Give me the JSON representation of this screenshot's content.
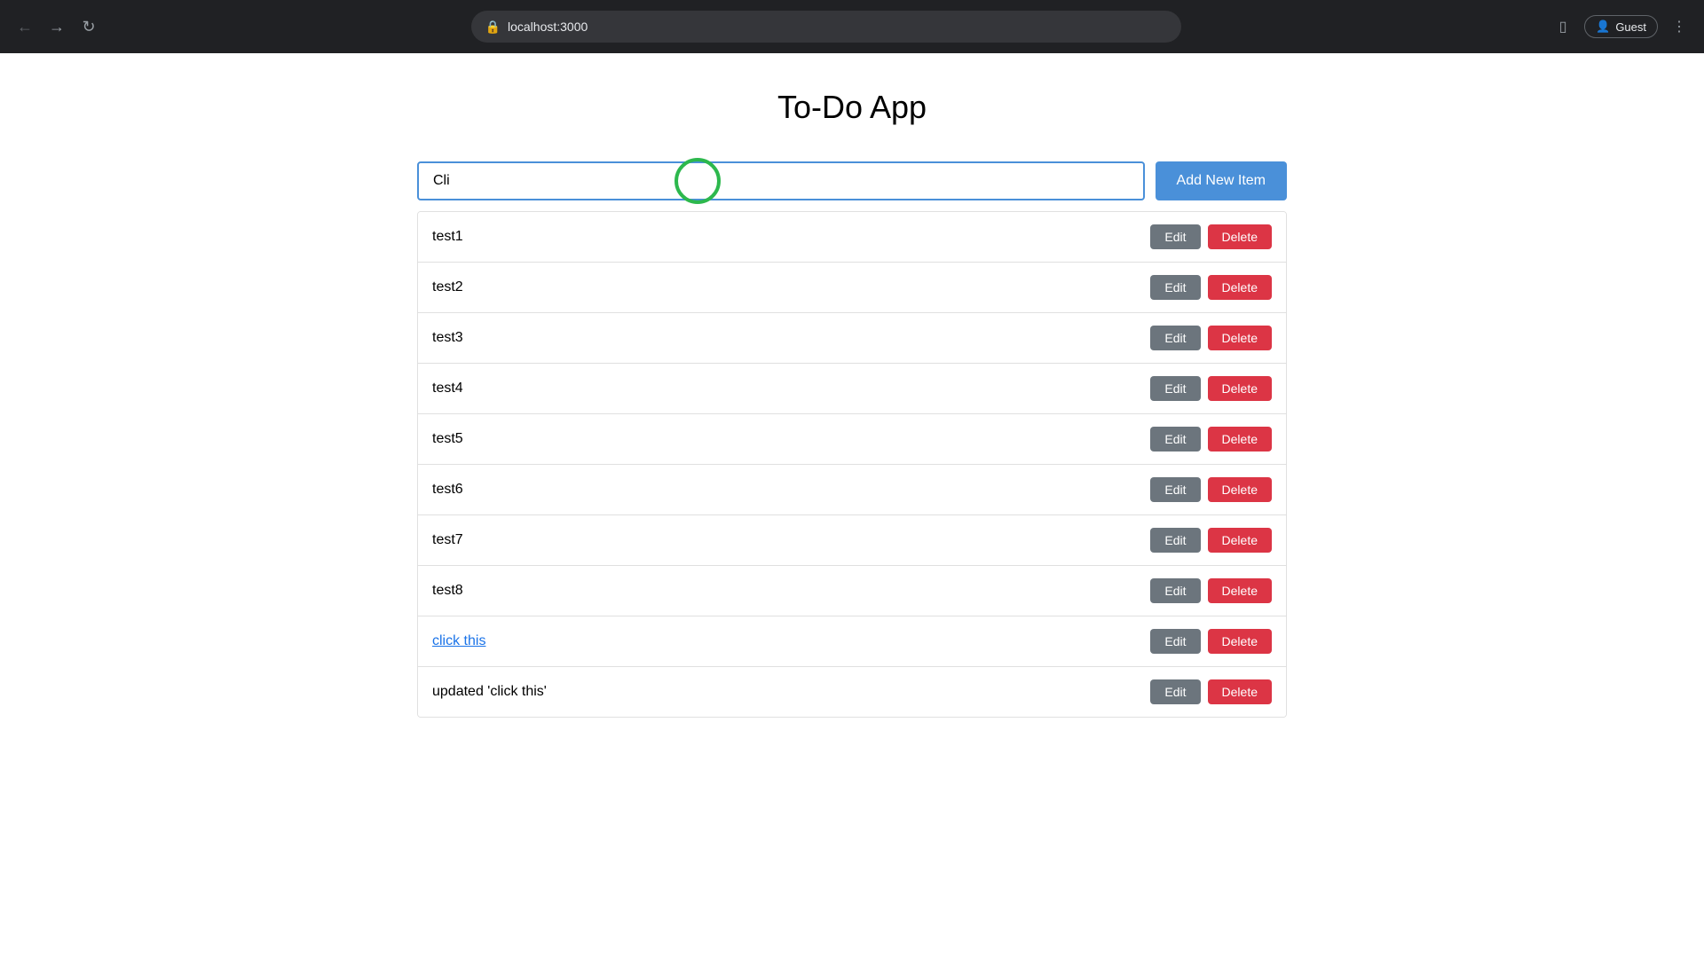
{
  "browser": {
    "url": "localhost:3000",
    "back_title": "←",
    "forward_title": "→",
    "refresh_title": "↻",
    "extensions_label": "⊞",
    "guest_label": "Guest"
  },
  "app": {
    "title": "To-Do App",
    "input": {
      "value": "Cli",
      "placeholder": ""
    },
    "add_button_label": "Add New Item",
    "items": [
      {
        "id": 1,
        "text": "test1",
        "is_link": false
      },
      {
        "id": 2,
        "text": "test2",
        "is_link": false
      },
      {
        "id": 3,
        "text": "test3",
        "is_link": false
      },
      {
        "id": 4,
        "text": "test4",
        "is_link": false
      },
      {
        "id": 5,
        "text": "test5",
        "is_link": false
      },
      {
        "id": 6,
        "text": "test6",
        "is_link": false
      },
      {
        "id": 7,
        "text": "test7",
        "is_link": false
      },
      {
        "id": 8,
        "text": "test8",
        "is_link": false
      },
      {
        "id": 9,
        "text": "click this",
        "is_link": true
      },
      {
        "id": 10,
        "text": "updated 'click this'",
        "is_link": false
      }
    ],
    "edit_label": "Edit",
    "delete_label": "Delete"
  }
}
